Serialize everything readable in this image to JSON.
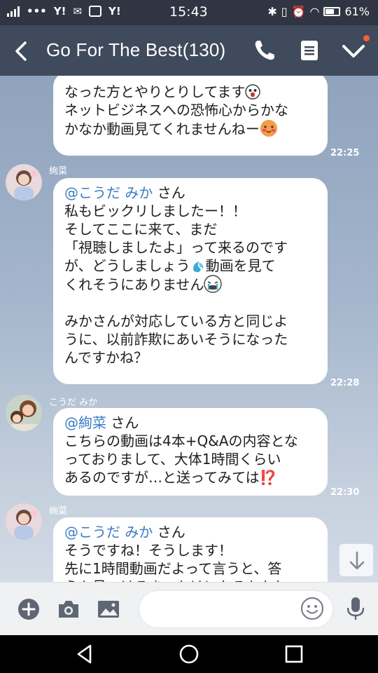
{
  "status_bar": {
    "carrier_a": "Y!",
    "carrier_b": "Y!",
    "time": "15:43",
    "battery": "61%"
  },
  "header": {
    "title": "Go For The Best(130)"
  },
  "messages": [
    {
      "sender": "",
      "text_1": "なった方とやりとりしてます",
      "text_2": "ネットビジネスへの恐怖心からかな\nかなか動画見てくれませんねー",
      "time": "22:25"
    },
    {
      "sender": "絢菜",
      "mention": "@こうだ みか",
      "mention_suffix": " さん",
      "text_1": "私もビックリしましたー！！\nそしてここに来て、まだ\n「視聴しましたよ」って来るのです\nが、どうしましょう",
      "text_2": "動画を見て\nくれそうにありません",
      "text_3": "\n\nみかさんが対応している方と同じよ\nうに、以前詐欺にあいそうになった\nんですかね？",
      "time": "22:28"
    },
    {
      "sender": "こうだ みか",
      "mention": "@絢菜",
      "mention_suffix": " さん",
      "text_1": "こちらの動画は4本+Q&Aの内容とな\nっておりまして、大体1時間くらい\nあるのですが…と送ってみては",
      "emoji_1": "⁉️",
      "time": "22:30"
    },
    {
      "sender": "絢菜",
      "mention": "@こうだ みか",
      "mention_suffix": " さん",
      "text_1": "そうですね！そうします！\n先に1時間動画だよって言うと、答\nえを見つけるきっかけになるかもし"
    }
  ],
  "icons": {
    "back": "chevron-left-icon",
    "call": "phone-icon",
    "notes": "note-icon",
    "menu": "chevron-down-icon",
    "add": "plus-icon",
    "camera": "camera-icon",
    "gallery": "image-icon",
    "emoji": "smiley-icon",
    "mic": "microphone-icon"
  },
  "colors": {
    "header_bg": "#3f4a5c",
    "mention": "#3b7dc4",
    "notification_dot": "#ff5a3c"
  }
}
